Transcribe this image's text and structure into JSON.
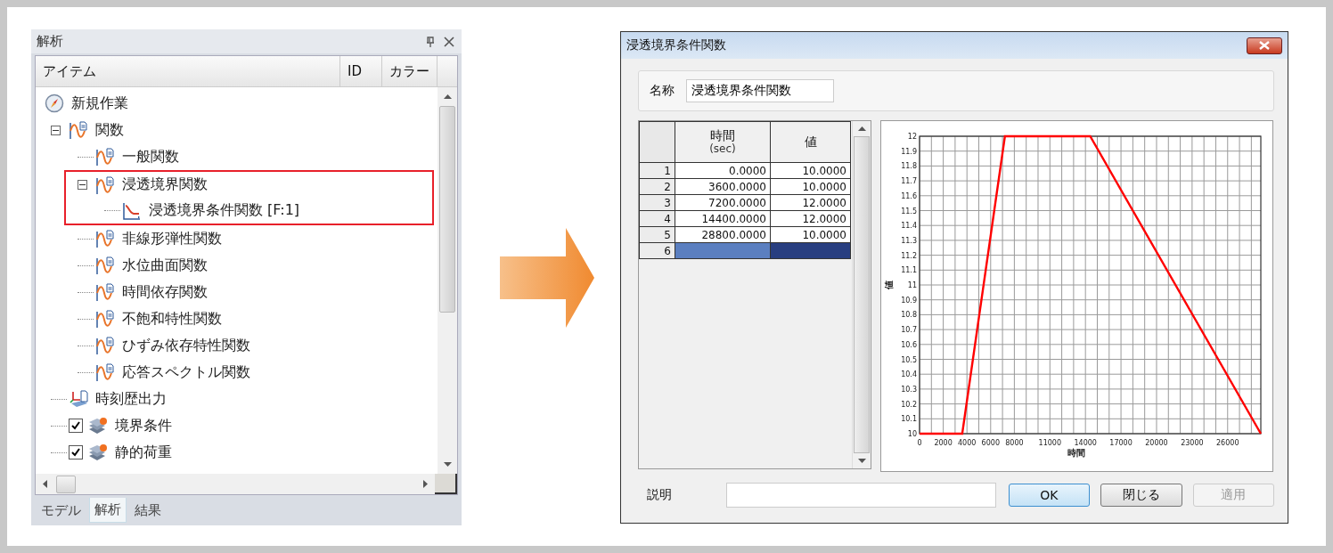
{
  "panel": {
    "title": "解析",
    "columns": [
      "アイテム",
      "ID",
      "カラー"
    ],
    "tree": [
      {
        "label": "新規作業",
        "kind": "task",
        "children": [
          {
            "label": "関数",
            "kind": "function",
            "expanded": true,
            "children": [
              {
                "label": "一般関数",
                "kind": "function",
                "highlighted": false
              },
              {
                "label": "浸透境界関数",
                "kind": "function",
                "expanded": true,
                "highlighted": true,
                "children": [
                  {
                    "label": "浸透境界条件関数 [F:1]",
                    "kind": "curve"
                  }
                ]
              },
              {
                "label": "非線形弾性関数",
                "kind": "function",
                "highlighted": false
              },
              {
                "label": "水位曲面関数",
                "kind": "function",
                "highlighted": false
              },
              {
                "label": "時間依存関数",
                "kind": "function",
                "highlighted": false
              },
              {
                "label": "不飽和特性関数",
                "kind": "function",
                "highlighted": false
              },
              {
                "label": "ひずみ依存特性関数",
                "kind": "function",
                "highlighted": false
              },
              {
                "label": "応答スペクトル関数",
                "kind": "function",
                "highlighted": false
              }
            ]
          },
          {
            "label": "時刻歴出力",
            "kind": "output"
          },
          {
            "label": "境界条件",
            "kind": "condition",
            "checked": true
          },
          {
            "label": "静的荷重",
            "kind": "condition",
            "checked": true
          }
        ]
      }
    ],
    "tabs": [
      {
        "label": "モデル",
        "selected": false
      },
      {
        "label": "解析",
        "selected": true
      },
      {
        "label": "結果",
        "selected": false
      }
    ]
  },
  "dialog": {
    "title": "浸透境界条件関数",
    "name_label": "名称",
    "name_value": "浸透境界条件関数",
    "table": {
      "columns": [
        {
          "label": "時間",
          "unit": "(sec)"
        },
        {
          "label": "値"
        }
      ],
      "rows": [
        {
          "index": "1",
          "selected": false,
          "cells": [
            "0.0000",
            "10.0000"
          ]
        },
        {
          "index": "2",
          "selected": false,
          "cells": [
            "3600.0000",
            "10.0000"
          ]
        },
        {
          "index": "3",
          "selected": false,
          "cells": [
            "7200.0000",
            "12.0000"
          ]
        },
        {
          "index": "4",
          "selected": false,
          "cells": [
            "14400.0000",
            "12.0000"
          ]
        },
        {
          "index": "5",
          "selected": false,
          "cells": [
            "28800.0000",
            "10.0000"
          ]
        },
        {
          "index": "6",
          "selected": true
        }
      ]
    },
    "chart_data": {
      "type": "line",
      "xlabel": "時間",
      "ylabel": "値",
      "x": [
        0,
        3600,
        7200,
        14400,
        28800
      ],
      "series": [
        {
          "color": "#ff0000",
          "values": [
            10,
            10,
            12,
            12,
            10
          ]
        }
      ],
      "grid": true,
      "xlim": [
        0,
        28800
      ],
      "ylim": [
        10,
        12
      ],
      "xticks": [
        0,
        2000,
        4000,
        6000,
        8000,
        11000,
        14000,
        17000,
        20000,
        23000,
        26000
      ],
      "yticks": [
        10,
        10.1,
        10.2,
        10.3,
        10.4,
        10.5,
        10.6,
        10.7,
        10.8,
        10.9,
        11,
        11.1,
        11.2,
        11.3,
        11.4,
        11.5,
        11.6,
        11.7,
        11.8,
        11.9,
        12
      ]
    },
    "description_label": "説明",
    "buttons": [
      {
        "label": "OK",
        "default": true,
        "disabled": false
      },
      {
        "label": "閉じる",
        "default": false,
        "disabled": false
      },
      {
        "label": "適用",
        "default": false,
        "disabled": true
      }
    ]
  }
}
